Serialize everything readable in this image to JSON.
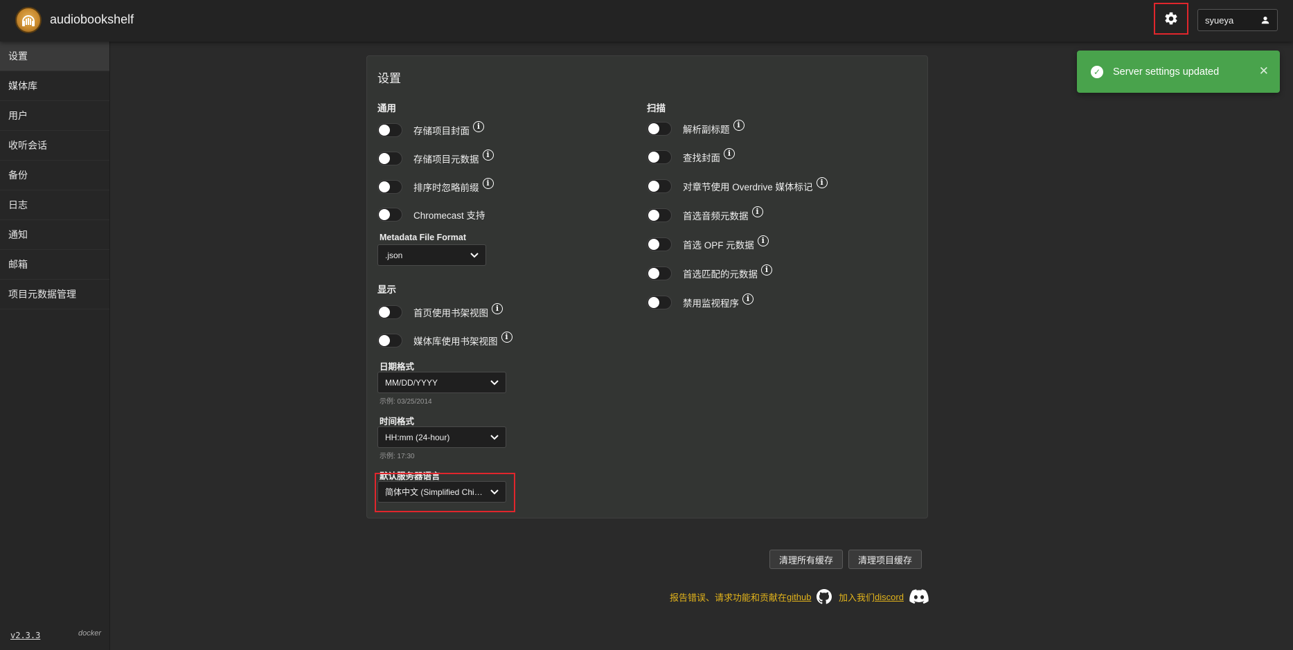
{
  "app": {
    "title": "audiobookshelf"
  },
  "header": {
    "username": "syueya"
  },
  "sidebar": {
    "items": [
      {
        "label": "设置"
      },
      {
        "label": "媒体库"
      },
      {
        "label": "用户"
      },
      {
        "label": "收听会话"
      },
      {
        "label": "备份"
      },
      {
        "label": "日志"
      },
      {
        "label": "通知"
      },
      {
        "label": "邮箱"
      },
      {
        "label": "项目元数据管理"
      }
    ],
    "version": "v2.3.3",
    "install": "docker"
  },
  "settings": {
    "title": "设置",
    "general": {
      "title": "通用",
      "store_cover": "存储项目封面",
      "store_metadata": "存储项目元数据",
      "ignore_prefixes": "排序时忽略前缀",
      "chromecast": "Chromecast 支持",
      "metadata_format_label": "Metadata File Format",
      "metadata_format_value": ".json"
    },
    "display": {
      "title": "显示",
      "home_bookshelf": "首页使用书架视图",
      "library_bookshelf": "媒体库使用书架视图",
      "date_format_label": "日期格式",
      "date_format_value": "MM/DD/YYYY",
      "date_example": "示例: 03/25/2014",
      "time_format_label": "时间格式",
      "time_format_value": "HH:mm (24-hour)",
      "time_example": "示例: 17:30",
      "language_label": "默认服务器语言",
      "language_value": "简体中文 (Simplified Chi…"
    },
    "scanner": {
      "title": "扫描",
      "parse_subtitles": "解析副标题",
      "find_covers": "查找封面",
      "overdrive_chapters": "对章节使用 Overdrive 媒体标记",
      "prefer_audio_metadata": "首选音频元数据",
      "prefer_opf_metadata": "首选 OPF 元数据",
      "prefer_matched_metadata": "首选匹配的元数据",
      "disable_watcher": "禁用监视程序"
    }
  },
  "cache": {
    "purge_all": "清理所有缓存",
    "purge_items": "清理项目缓存"
  },
  "footer": {
    "report_text": "报告错误、请求功能和贡献在",
    "github": "github",
    "join_text": "加入我们",
    "discord": "discord"
  },
  "toast": {
    "message": "Server settings updated",
    "close": "✕"
  },
  "colors": {
    "accent_red": "#e0262c",
    "toast_green": "#49a34c",
    "link_yellow": "#e3b41b"
  }
}
